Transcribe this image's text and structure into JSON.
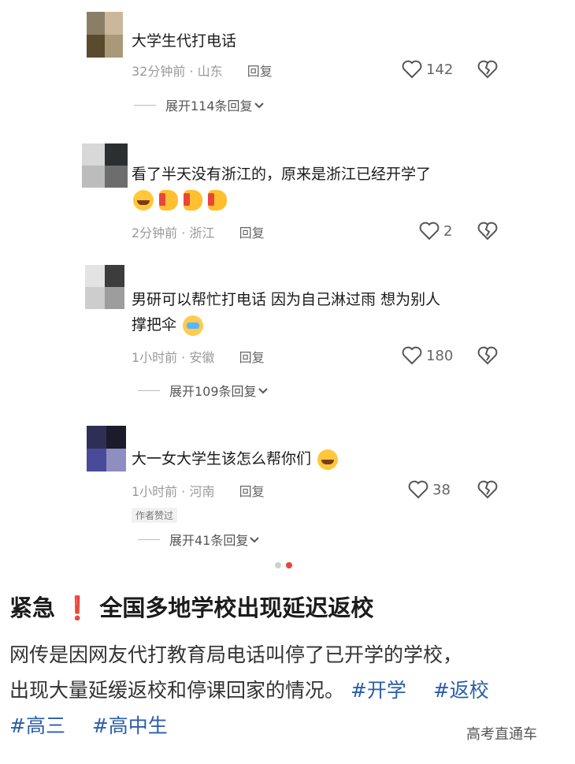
{
  "comments": [
    {
      "text": "大学生代打电话",
      "time": "32分钟前",
      "separator": "·",
      "location": "山东",
      "reply": "回复",
      "likes": "142",
      "expand": "展开114条回复"
    },
    {
      "text": "看了半天没有浙江的，原来是浙江已经开学了",
      "time": "2分钟前",
      "separator": "·",
      "location": "浙江",
      "reply": "回复",
      "likes": "2",
      "emojis": [
        "laugh-cry-emoji",
        "thumbs-up-emoji",
        "thumbs-up-emoji",
        "thumbs-up-emoji"
      ]
    },
    {
      "text": "男研可以帮忙打电话 因为自己淋过雨 想为别人",
      "text2": "撑把伞",
      "time": "1小时前",
      "separator": "·",
      "location": "安徽",
      "reply": "回复",
      "likes": "180",
      "expand": "展开109条回复",
      "emojis": [
        "crying-emoji"
      ]
    },
    {
      "text": "大一女大学生该怎么帮你们",
      "time": "1小时前",
      "separator": "·",
      "location": "河南",
      "reply": "回复",
      "likes": "38",
      "badge": "作者赞过",
      "expand": "展开41条回复",
      "emojis": [
        "laughing-emoji"
      ]
    }
  ],
  "headline": {
    "prefix": "紧急",
    "mark": "❗",
    "title": "全国多地学校出现延迟返校"
  },
  "body": {
    "line1": "网传是因网友代打教育局电话叫停了已开学的学校，",
    "line2": "出现大量延缓返校和停课回家的情况。",
    "tags_line2": [
      "#开学",
      "#返校"
    ],
    "tags_line3": [
      "#高三",
      "#高中生"
    ]
  },
  "watermark": "高考直通车",
  "colors": {
    "accent_red": "#e8453c",
    "tag_blue": "#2a5fa8"
  }
}
